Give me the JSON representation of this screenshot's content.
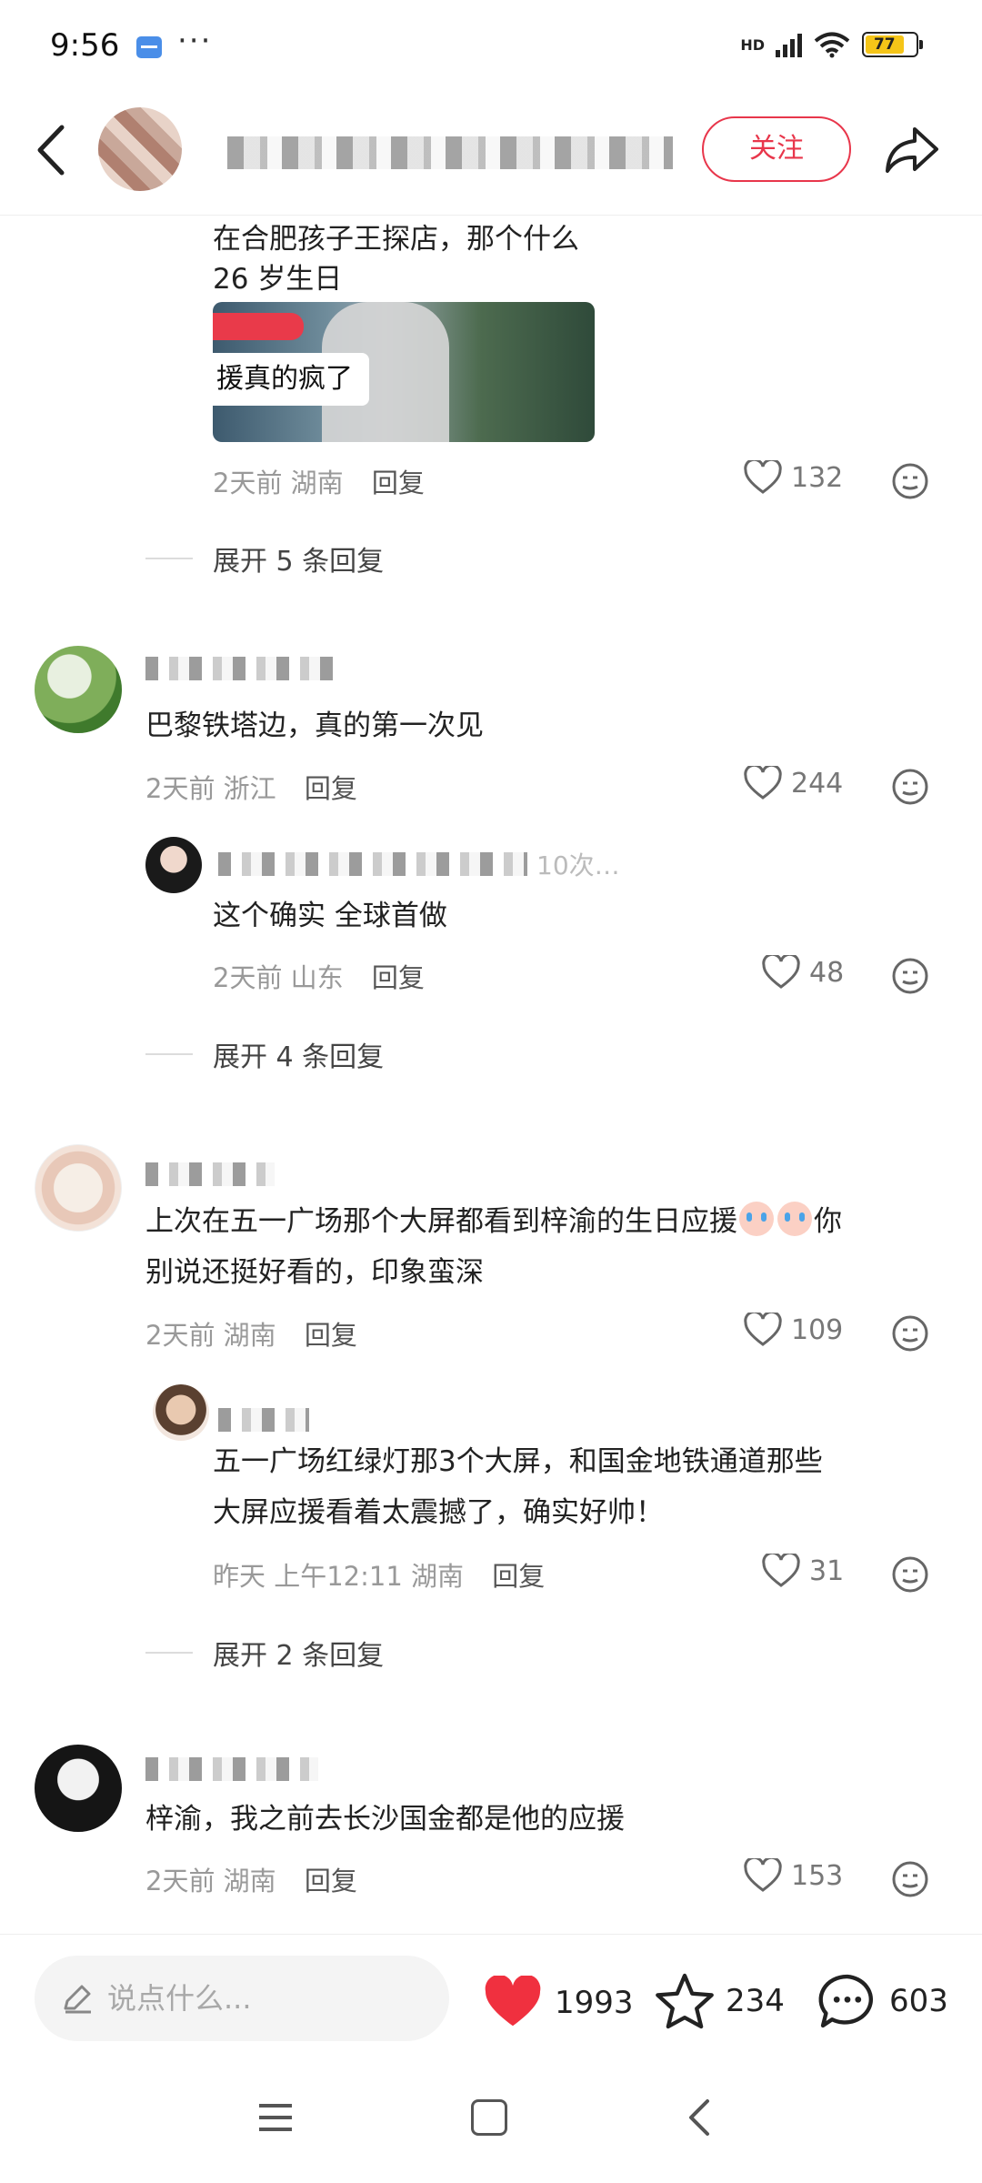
{
  "status_bar": {
    "time": "9:56",
    "dots": "···",
    "network_label": "HD",
    "battery": "77"
  },
  "header": {
    "follow_label": "关注"
  },
  "comments": [
    {
      "text_lines": [
        "在合肥孩子王探店，那个什么",
        "26 岁生日"
      ],
      "image_caption": "援真的疯了",
      "time": "2天前",
      "location": "湖南",
      "reply_label": "回复",
      "likes": "132"
    },
    {
      "expand_label": "展开 5 条回复"
    },
    {
      "text": "巴黎铁塔边，真的第一次见",
      "time": "2天前",
      "location": "浙江",
      "reply_label": "回复",
      "likes": "244",
      "reply": {
        "name_tail": "10次…",
        "text": "这个确实 全球首做",
        "time": "2天前",
        "location": "山东",
        "reply_label": "回复",
        "likes": "48"
      },
      "expand_label": "展开 4 条回复"
    },
    {
      "text_part1": "上次在五一广场那个大屏都看到梓渝的生日应援",
      "text_part2": "你",
      "text_line2": "别说还挺好看的，印象蛮深",
      "time": "2天前",
      "location": "湖南",
      "reply_label": "回复",
      "likes": "109",
      "reply": {
        "text_lines": [
          "五一广场红绿灯那3个大屏，和国金地铁通道那些",
          "大屏应援看着太震撼了，确实好帅！"
        ],
        "time": "昨天 上午12:11",
        "location": "湖南",
        "reply_label": "回复",
        "likes": "31"
      },
      "expand_label": "展开 2 条回复"
    },
    {
      "text": "梓渝，我之前去长沙国金都是他的应援",
      "time": "2天前",
      "location": "湖南",
      "reply_label": "回复",
      "likes": "153"
    }
  ],
  "bottom_bar": {
    "input_placeholder": "说点什么...",
    "likes": "1993",
    "favorites": "234",
    "comments": "603",
    "like_color": "#f0303f"
  },
  "icons": [
    "back-arrow-icon",
    "share-icon",
    "heart-icon",
    "emoji-react-icon",
    "pencil-icon",
    "star-icon",
    "comment-bubble-icon",
    "menu-icon",
    "home-icon",
    "nav-back-icon"
  ]
}
